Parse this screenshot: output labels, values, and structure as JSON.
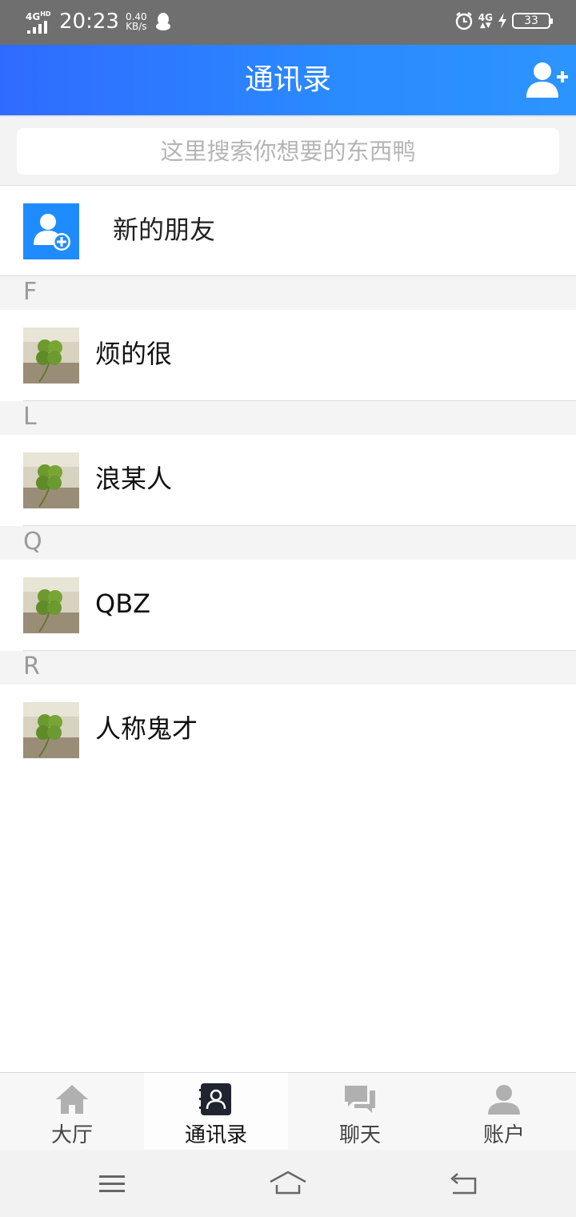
{
  "status_bar": {
    "network_left": "4G",
    "network_left_sup": "HD",
    "time": "20:23",
    "speed_value": "0.40",
    "speed_unit": "KB/s",
    "network_right": "4G",
    "battery": "33"
  },
  "header": {
    "title": "通讯录",
    "add_icon": "add-contact-icon"
  },
  "search": {
    "placeholder": "这里搜索你想要的东西鸭"
  },
  "new_friends": {
    "label": "新的朋友",
    "icon": "add-friend-icon"
  },
  "contact_groups": [
    {
      "letter": "F",
      "contacts": [
        {
          "name": "烦的很"
        }
      ]
    },
    {
      "letter": "L",
      "contacts": [
        {
          "name": "浪某人"
        }
      ]
    },
    {
      "letter": "Q",
      "contacts": [
        {
          "name": "QBZ"
        }
      ]
    },
    {
      "letter": "R",
      "contacts": [
        {
          "name": "人称鬼才"
        }
      ]
    }
  ],
  "tabs": [
    {
      "label": "大厅",
      "icon": "home-icon",
      "active": false
    },
    {
      "label": "通讯录",
      "icon": "contacts-book-icon",
      "active": true
    },
    {
      "label": "聊天",
      "icon": "chat-bubbles-icon",
      "active": false
    },
    {
      "label": "账户",
      "icon": "person-icon",
      "active": false
    }
  ],
  "colors": {
    "header_start": "#2f6bff",
    "header_end": "#2c94ff",
    "new_friend_icon_bg": "#1e8cff",
    "active_tab_icon": "#1f2430",
    "inactive_tab_icon": "#b0b0b0"
  }
}
